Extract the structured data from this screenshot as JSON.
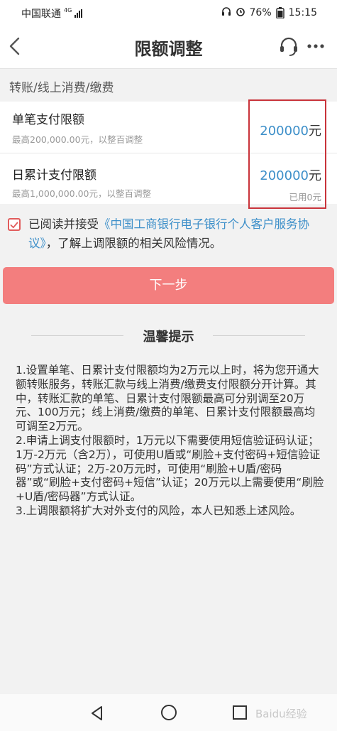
{
  "status_bar": {
    "carrier": "中国联通",
    "network": "4G",
    "battery": "76%",
    "time": "15:15"
  },
  "header": {
    "title": "限额调整"
  },
  "section": {
    "title": "转账/线上消费/缴费"
  },
  "limits": [
    {
      "label": "单笔支付限额",
      "hint": "最高200,000.00元，以整百调整",
      "value": "200000",
      "unit": "元"
    },
    {
      "label": "日累计支付限额",
      "hint": "最高1,000,000.00元，以整百调整",
      "value": "200000",
      "unit": "元",
      "used": "已用0元"
    }
  ],
  "agreement": {
    "checked": true,
    "prefix": "已阅读并接受",
    "link": "《中国工商银行电子银行个人客户服务协议》",
    "suffix": "，了解上调限额的相关风险情况。"
  },
  "next_button": {
    "label": "下一步"
  },
  "tips": {
    "title": "温馨提示",
    "items": [
      "1.设置单笔、日累计支付限额均为2万元以上时，将为您开通大额转账服务，转账汇款与线上消费/缴费支付限额分开计算。其中，转账汇款的单笔、日累计支付限额最高可分别调至20万元、100万元；线上消费/缴费的单笔、日累计支付限额最高均可调至2万元。",
      "2.申请上调支付限额时，1万元以下需要使用短信验证码认证；1万-2万元（含2万），可使用U盾或“刷脸+支付密码+短信验证码”方式认证；2万-20万元时，可使用“刷脸+U盾/密码器”或“刷脸+支付密码+短信”认证；20万元以上需要使用“刷脸+U盾/密码器”方式认证。",
      "3.上调限额将扩大对外支付的风险，本人已知悉上述风险。"
    ]
  },
  "watermark": "Baidu经验",
  "colors": {
    "accent_blue": "#3d8fc9",
    "button_red": "#f37e7e",
    "highlight_box": "#c9333a"
  }
}
